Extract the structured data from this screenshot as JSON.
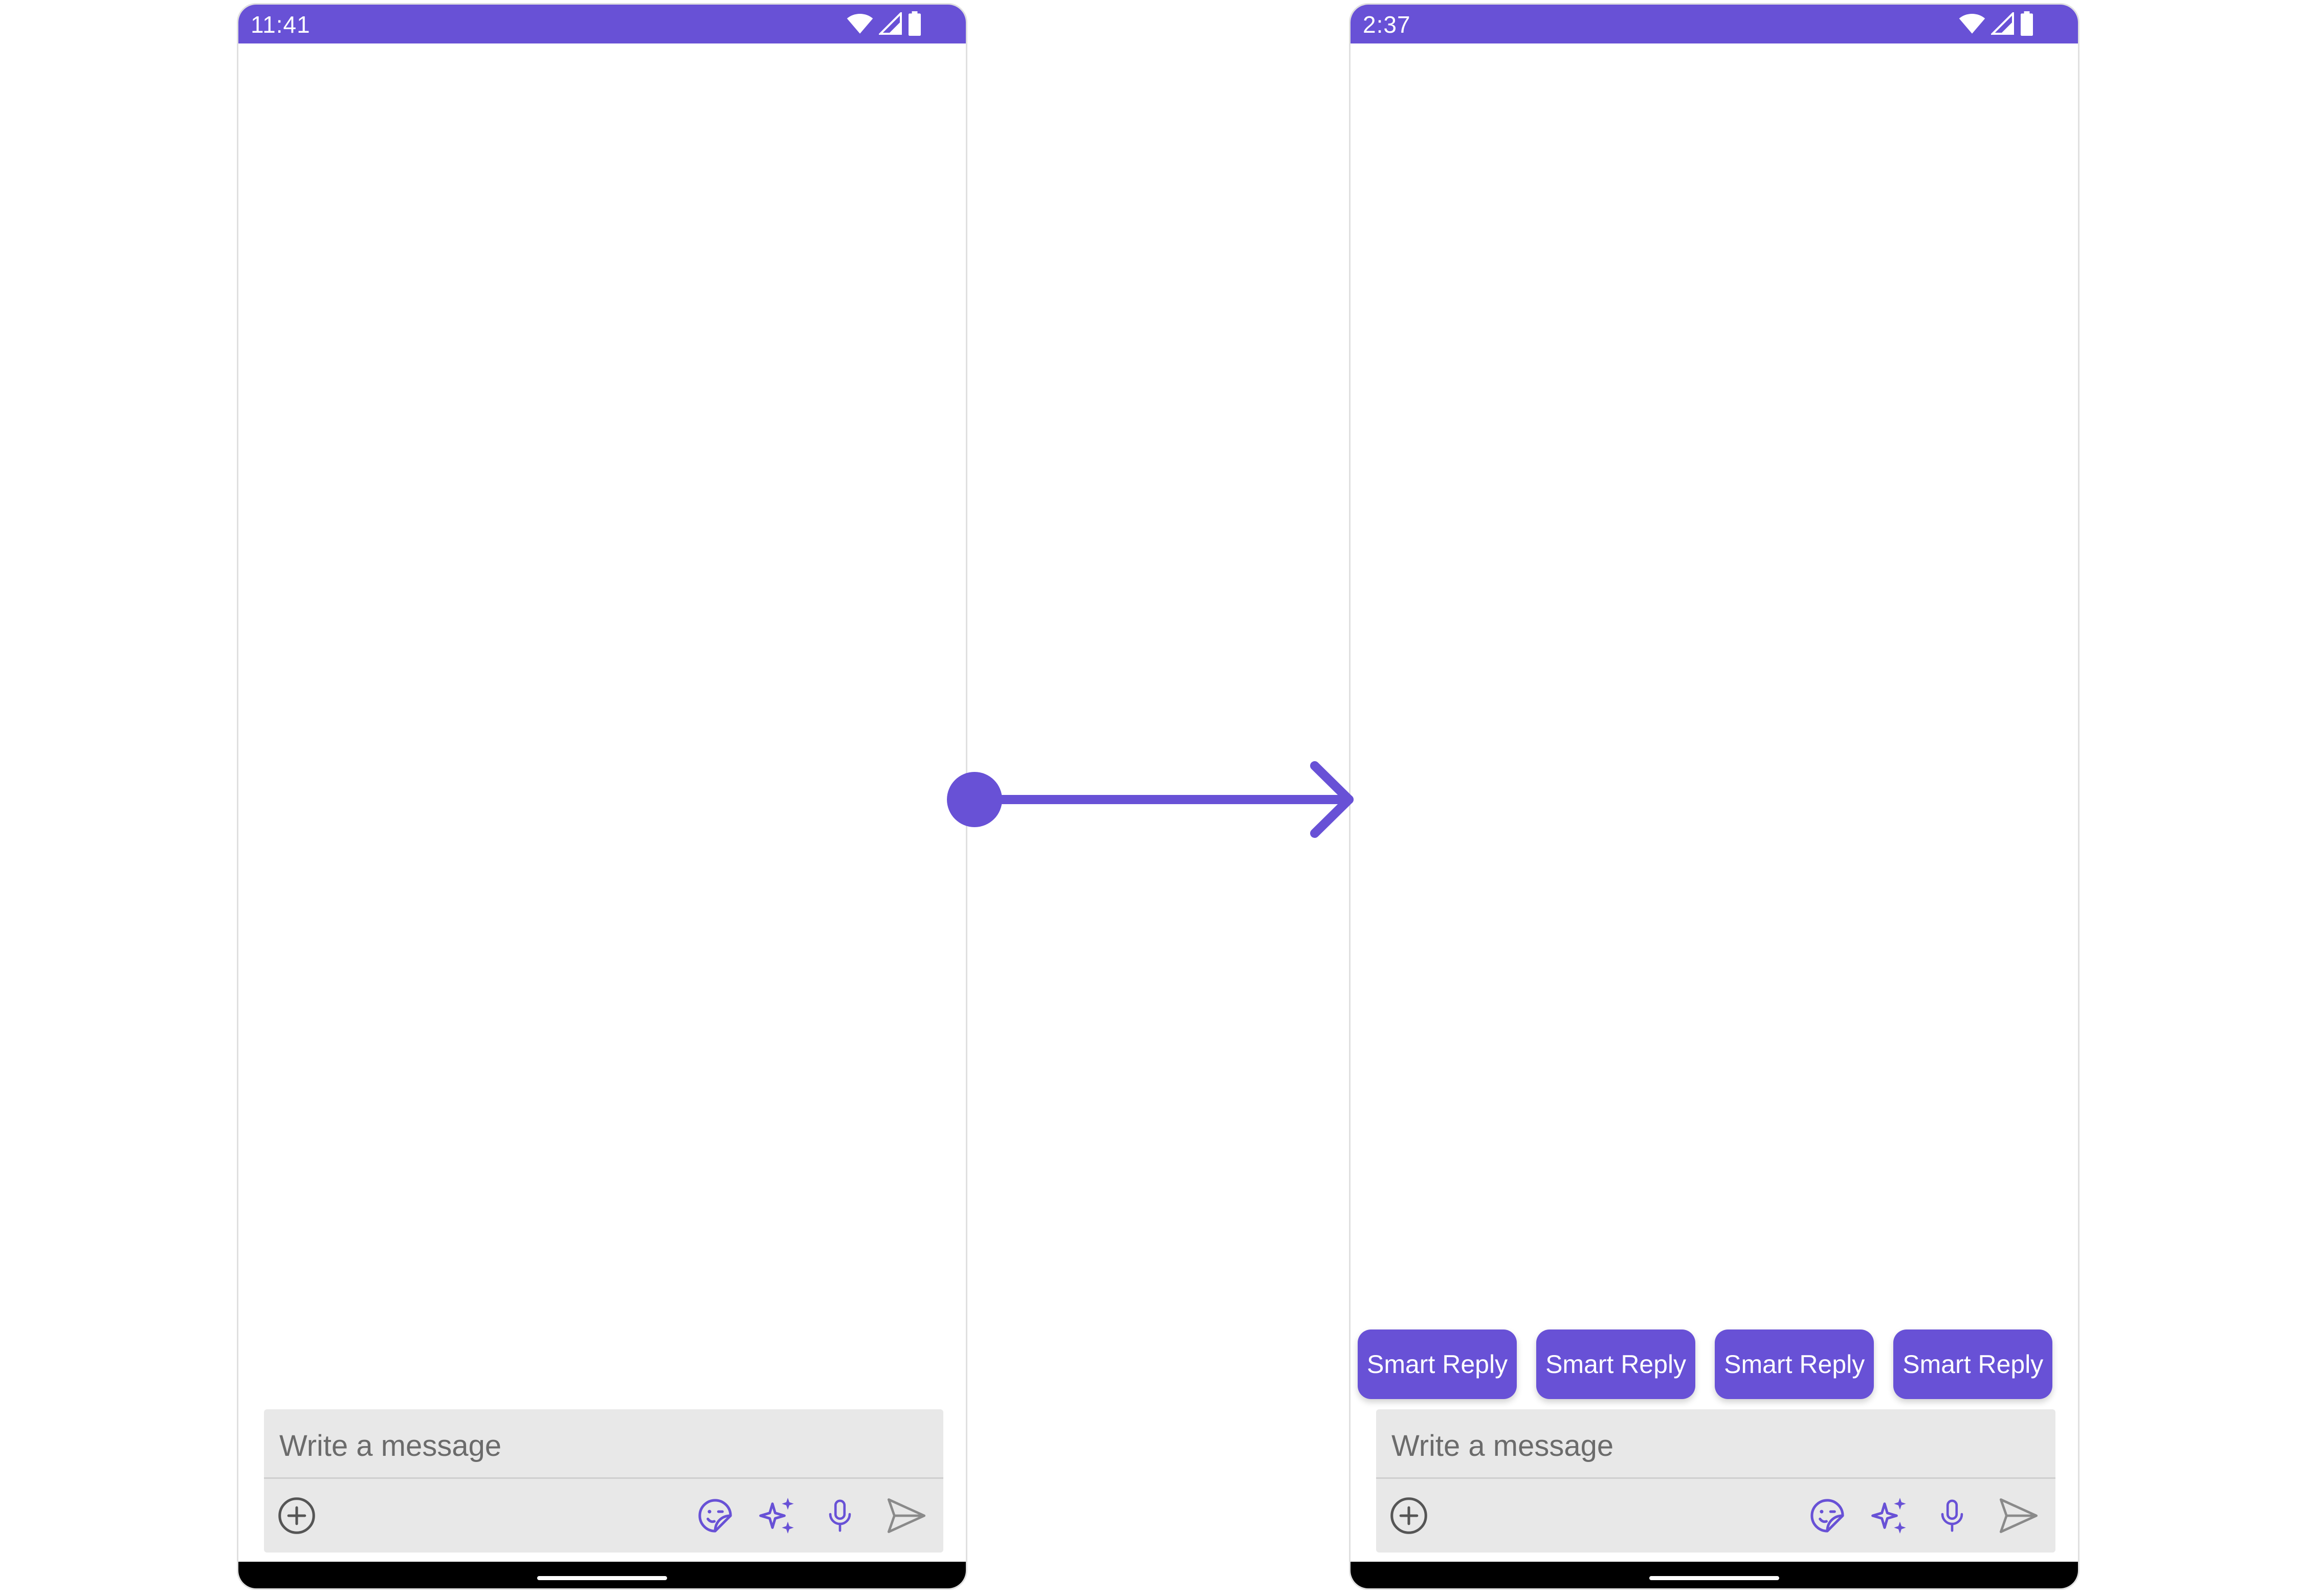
{
  "colors": {
    "accent": "#6851D6",
    "composer_bg": "#e8e8e8",
    "placeholder_text": "#6b6b6b",
    "icon_gray": "#555555"
  },
  "screens": [
    {
      "status_bar": {
        "time": "11:41"
      },
      "composer": {
        "placeholder": "Write a message",
        "icons": [
          "add-circle-icon",
          "sticker-icon",
          "ai-sparkle-icon",
          "microphone-icon",
          "send-icon"
        ]
      }
    },
    {
      "status_bar": {
        "time": "2:37"
      },
      "smart_replies": [
        "Smart Reply",
        "Smart Reply",
        "Smart Reply",
        "Smart Reply"
      ],
      "composer": {
        "placeholder": "Write a message",
        "icons": [
          "add-circle-icon",
          "sticker-icon",
          "ai-sparkle-icon",
          "microphone-icon",
          "send-icon"
        ]
      }
    }
  ]
}
